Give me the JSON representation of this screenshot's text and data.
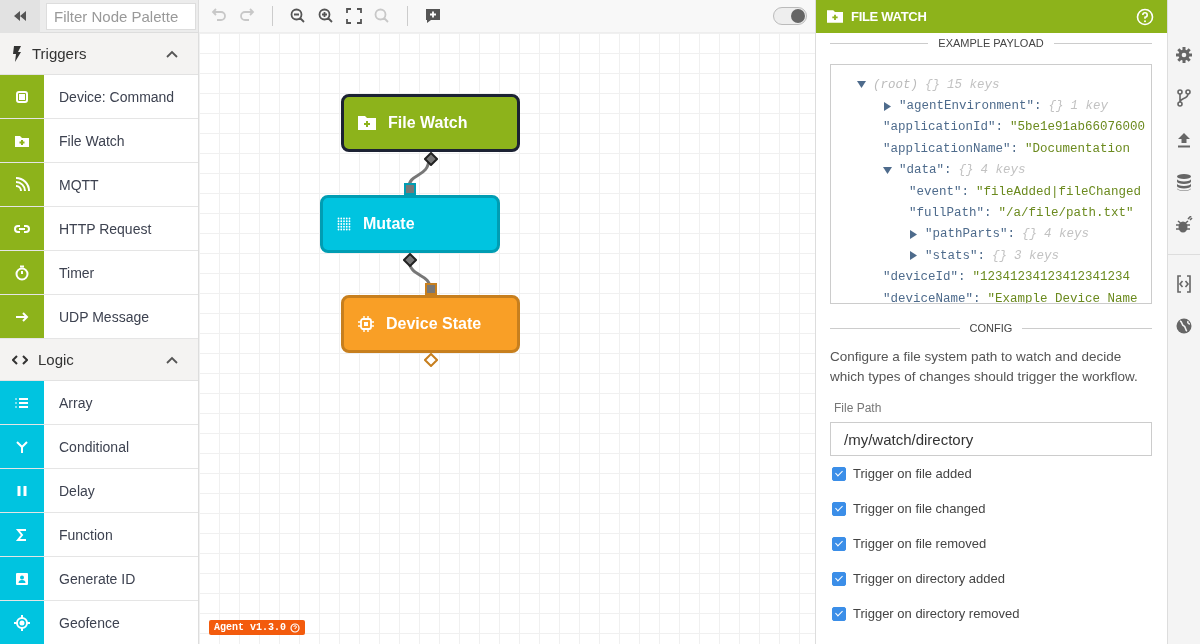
{
  "palette": {
    "filter": {
      "placeholder": "Filter Node Palette"
    },
    "sections": [
      {
        "title": "Triggers",
        "expanded": true,
        "color": "#8db31b",
        "items": [
          {
            "label": "Device: Command"
          },
          {
            "label": "File Watch"
          },
          {
            "label": "MQTT"
          },
          {
            "label": "HTTP Request"
          },
          {
            "label": "Timer"
          },
          {
            "label": "UDP Message"
          }
        ]
      },
      {
        "title": "Logic",
        "expanded": true,
        "color": "#00c4e0",
        "items": [
          {
            "label": "Array"
          },
          {
            "label": "Conditional"
          },
          {
            "label": "Delay"
          },
          {
            "label": "Function"
          },
          {
            "label": "Generate ID"
          },
          {
            "label": "Geofence"
          }
        ]
      }
    ]
  },
  "toolbar": [
    {
      "kind": "undo",
      "disabled": true
    },
    {
      "kind": "redo",
      "disabled": true
    },
    {
      "kind": "zoom-out",
      "disabled": false
    },
    {
      "kind": "zoom-in",
      "disabled": false
    },
    {
      "kind": "fit",
      "disabled": false
    },
    {
      "kind": "zoom-reset",
      "disabled": true
    },
    {
      "kind": "comment",
      "disabled": false
    }
  ],
  "canvas_toggle": {
    "on": true
  },
  "nodes": [
    {
      "label": "File Watch",
      "color": "#8db31b",
      "selected": true
    },
    {
      "label": "Mutate",
      "color": "#00c4e0",
      "selected": false
    },
    {
      "label": "Device State",
      "color": "#f99f26",
      "selected": false
    }
  ],
  "agent_badge": "Agent v1.3.0",
  "panel": {
    "title": "FILE WATCH",
    "payload": {
      "heading": "EXAMPLE PAYLOAD",
      "tree": {
        "key": "(root)",
        "brace": "{}",
        "count": "15 keys",
        "expanded": true,
        "children": [
          {
            "key": "\"agentEnvironment\":",
            "brace": "{}",
            "count": "1 key",
            "expanded": false
          },
          {
            "key": "\"applicationId\":",
            "value": "\"5be1e91ab66076000"
          },
          {
            "key": "\"applicationName\":",
            "value": "\"Documentation"
          },
          {
            "key": "\"data\":",
            "brace": "{}",
            "count": "4 keys",
            "expanded": true,
            "children": [
              {
                "key": "\"event\":",
                "value": "\"fileAdded|fileChanged"
              },
              {
                "key": "\"fullPath\":",
                "value": "\"/a/file/path.txt\""
              },
              {
                "key": "\"pathParts\":",
                "brace": "{}",
                "count": "4 keys",
                "expanded": false
              },
              {
                "key": "\"stats\":",
                "brace": "{}",
                "count": "3 keys",
                "expanded": false
              }
            ]
          },
          {
            "key": "\"deviceId\":",
            "value": "\"12341234123412341234"
          },
          {
            "key": "\"deviceName\":",
            "value": "\"Example Device Name"
          }
        ]
      }
    },
    "config": {
      "heading": "CONFIG",
      "description": "Configure a file system path to watch and decide which types of changes should trigger the workflow.",
      "file_path": {
        "label": "File Path",
        "value": "/my/watch/directory"
      },
      "options": [
        {
          "label": "Trigger on file added",
          "checked": true
        },
        {
          "label": "Trigger on file changed",
          "checked": true
        },
        {
          "label": "Trigger on file removed",
          "checked": true
        },
        {
          "label": "Trigger on directory added",
          "checked": true
        },
        {
          "label": "Trigger on directory removed",
          "checked": true
        }
      ]
    }
  }
}
